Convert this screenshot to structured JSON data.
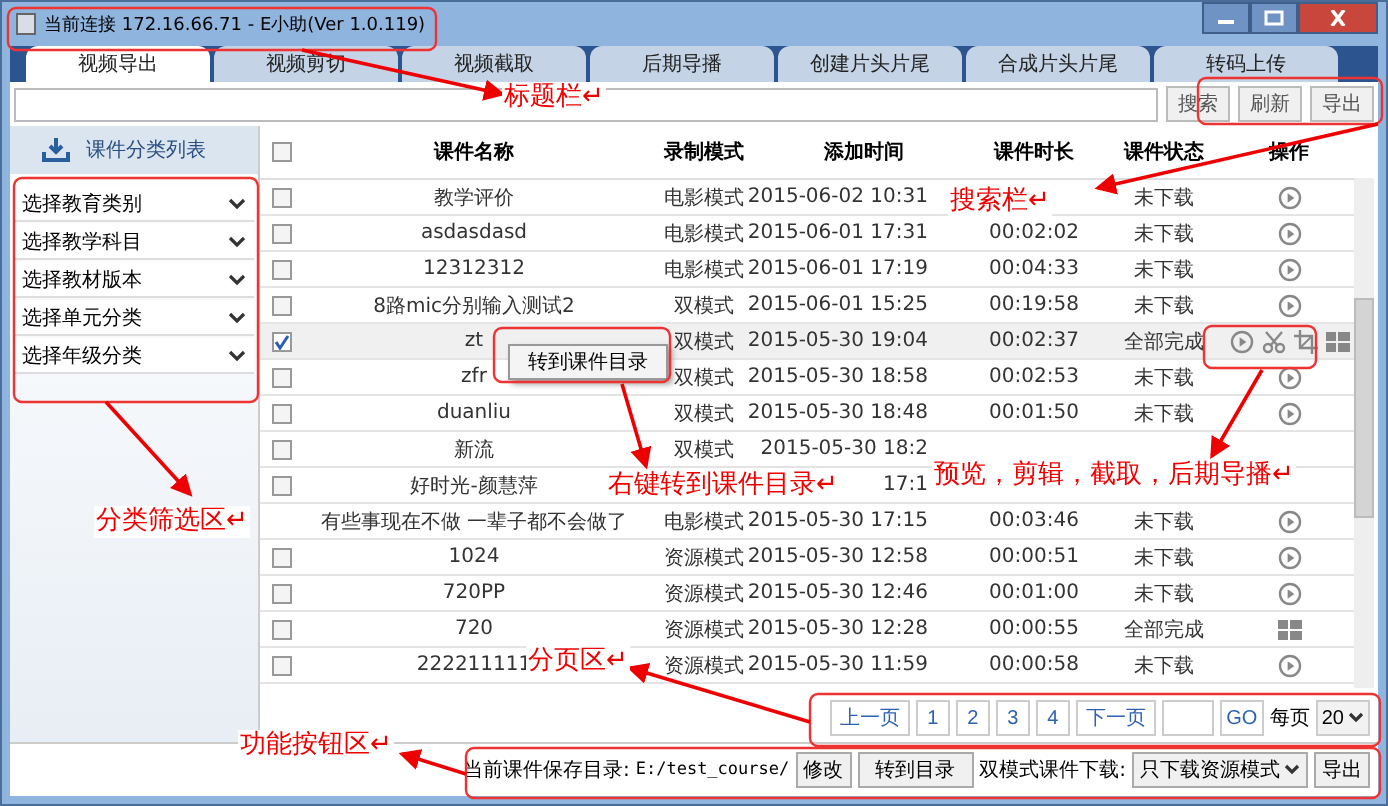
{
  "window": {
    "title": "当前连接 172.16.66.71  -  E小助(Ver 1.0.119)"
  },
  "tabs": [
    {
      "label": "视频导出",
      "selected": true
    },
    {
      "label": "视频剪切",
      "selected": false
    },
    {
      "label": "视频截取",
      "selected": false
    },
    {
      "label": "后期导播",
      "selected": false
    },
    {
      "label": "创建片头片尾",
      "selected": false
    },
    {
      "label": "合成片头片尾",
      "selected": false
    },
    {
      "label": "转码上传",
      "selected": false
    }
  ],
  "search": {
    "buttons": [
      "搜索",
      "刷新",
      "导出"
    ]
  },
  "sidebar": {
    "title": "课件分类列表",
    "filters": [
      "选择教育类别",
      "选择教学科目",
      "选择教材版本",
      "选择单元分类",
      "选择年级分类"
    ]
  },
  "table": {
    "select_all": {
      "checked": false
    },
    "columns": [
      "课件名称",
      "录制模式",
      "添加时间",
      "课件时长",
      "课件状态",
      "操作"
    ],
    "rows": [
      {
        "checked": false,
        "name": "教学评价",
        "mode": "电影模式",
        "date": "2015-06-02 10:31",
        "status": "未下载",
        "actions": [
          {
            "kind": "play"
          }
        ]
      },
      {
        "checked": false,
        "name": "asdasdasd",
        "mode": "电影模式",
        "date": "2015-06-01 17:31",
        "duration": "00:02:02",
        "status": "未下载",
        "actions": [
          {
            "kind": "play"
          }
        ]
      },
      {
        "checked": false,
        "name": "12312312",
        "mode": "电影模式",
        "date": "2015-06-01 17:19",
        "duration": "00:04:33",
        "status": "未下载",
        "actions": [
          {
            "kind": "play"
          }
        ]
      },
      {
        "checked": false,
        "name": "8路mic分别输入测试2",
        "mode": "双模式",
        "date": "2015-06-01 15:25",
        "duration": "00:19:58",
        "status": "未下载",
        "actions": [
          {
            "kind": "play"
          }
        ]
      },
      {
        "checked": true,
        "name": "zt",
        "mode": "双模式",
        "date": "2015-05-30 19:04",
        "duration": "00:02:37",
        "status": "全部完成",
        "actions": [
          {
            "kind": "play"
          },
          {
            "kind": "cut"
          },
          {
            "kind": "crop"
          },
          {
            "kind": "windows"
          }
        ]
      },
      {
        "checked": false,
        "name": "zfr",
        "mode": "双模式",
        "date": "2015-05-30 18:58",
        "duration": "00:02:53",
        "status": "未下载",
        "actions": [
          {
            "kind": "play"
          }
        ]
      },
      {
        "checked": false,
        "name": "duanliu",
        "mode": "双模式",
        "date": "2015-05-30 18:48",
        "duration": "00:01:50",
        "status": "未下载",
        "actions": [
          {
            "kind": "play"
          }
        ]
      },
      {
        "checked": false,
        "name": "新流",
        "mode": "双模式",
        "date": "2015-05-30 18:2"
      },
      {
        "checked": false,
        "name": "好时光-颜慧萍",
        "date": "17:1"
      },
      {
        "name": "有些事现在不做 一辈子都不会做了",
        "mode": "电影模式",
        "date": "2015-05-30 17:15",
        "duration": "00:03:46",
        "status": "未下载",
        "actions": [
          {
            "kind": "play"
          }
        ]
      },
      {
        "checked": false,
        "name": "1024",
        "mode": "资源模式",
        "date": "2015-05-30 12:58",
        "duration": "00:00:51",
        "status": "未下载",
        "actions": [
          {
            "kind": "play"
          }
        ]
      },
      {
        "checked": false,
        "name": "720PP",
        "mode": "资源模式",
        "date": "2015-05-30 12:46",
        "duration": "00:01:00",
        "status": "未下载",
        "actions": [
          {
            "kind": "play"
          }
        ]
      },
      {
        "checked": false,
        "name": "720",
        "mode": "资源模式",
        "date": "2015-05-30 12:28",
        "duration": "00:00:55",
        "status": "全部完成",
        "actions": [
          {
            "kind": "windows"
          }
        ]
      },
      {
        "checked": false,
        "name": "222211111",
        "mode": "资源模式",
        "date": "2015-05-30 11:59",
        "duration": "00:00:58",
        "status": "未下载",
        "actions": [
          {
            "kind": "play"
          }
        ]
      }
    ]
  },
  "context_menu": {
    "items": [
      "转到课件目录"
    ]
  },
  "pagination": {
    "prev": "上一页",
    "pages": [
      {
        "label": "1"
      },
      {
        "label": "2"
      },
      {
        "label": "3"
      },
      {
        "label": "4"
      }
    ],
    "next": "下一页",
    "go": "GO",
    "per_page_label": "每页",
    "per_page": "20"
  },
  "bottom_bar": {
    "dir_label": "当前课件保存目录:",
    "dir_value": "E:/test_course/",
    "modify": "修改",
    "goto": "转到目录",
    "download_label": "双模式课件下载:",
    "download_mode": "只下载资源模式",
    "export": "导出"
  },
  "annotations": [
    {
      "text": "标题栏↵"
    },
    {
      "text": "搜索栏↵"
    },
    {
      "text": "分类筛选区↵"
    },
    {
      "text": "右键转到课件目录↵"
    },
    {
      "text": "预览，剪辑，截取，后期导播↵"
    },
    {
      "text": "分页区↵"
    },
    {
      "text": "功能按钮区↵"
    }
  ]
}
